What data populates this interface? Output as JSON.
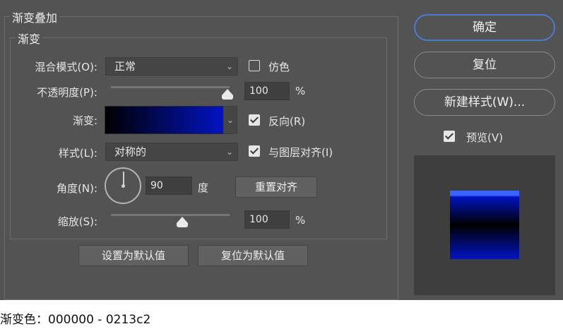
{
  "dialog": {
    "section_title": "渐变叠加",
    "group_title": "渐变"
  },
  "form": {
    "blend_mode": {
      "label": "混合模式(O):",
      "value": "正常"
    },
    "dither": {
      "label": "仿色",
      "checked": false
    },
    "opacity": {
      "label": "不透明度(P):",
      "value": "100",
      "unit": "%",
      "level_percent": 100
    },
    "gradient": {
      "label": "渐变:",
      "start_color": "#000000",
      "end_color": "#0213c2"
    },
    "reverse": {
      "label": "反向(R)",
      "checked": true
    },
    "style": {
      "label": "样式(L):",
      "value": "对称的"
    },
    "align_with_layer": {
      "label": "与图层对齐(I)",
      "checked": true
    },
    "angle": {
      "label": "角度(N):",
      "value": "90",
      "unit": "度",
      "reset_label": "重置对齐"
    },
    "scale": {
      "label": "缩放(S):",
      "value": "100",
      "unit": "%",
      "level_percent": 100
    }
  },
  "defaults_buttons": {
    "set_default": "设置为默认值",
    "reset_default": "复位为默认值"
  },
  "side_buttons": {
    "ok": "确定",
    "reset": "复位",
    "new_style": "新建样式(W)...",
    "preview": {
      "label": "预览(V)",
      "checked": true
    }
  },
  "caption": "渐变色：000000 - 0213c2",
  "icons": {
    "dropdown": "chevron-down-icon",
    "angle_dial": "angle-dial-icon"
  },
  "colors": {
    "dialog_bg": "#535353",
    "primary_outline": "#4a7bd4",
    "gradient_start": "#000000",
    "gradient_end": "#0213c2"
  }
}
